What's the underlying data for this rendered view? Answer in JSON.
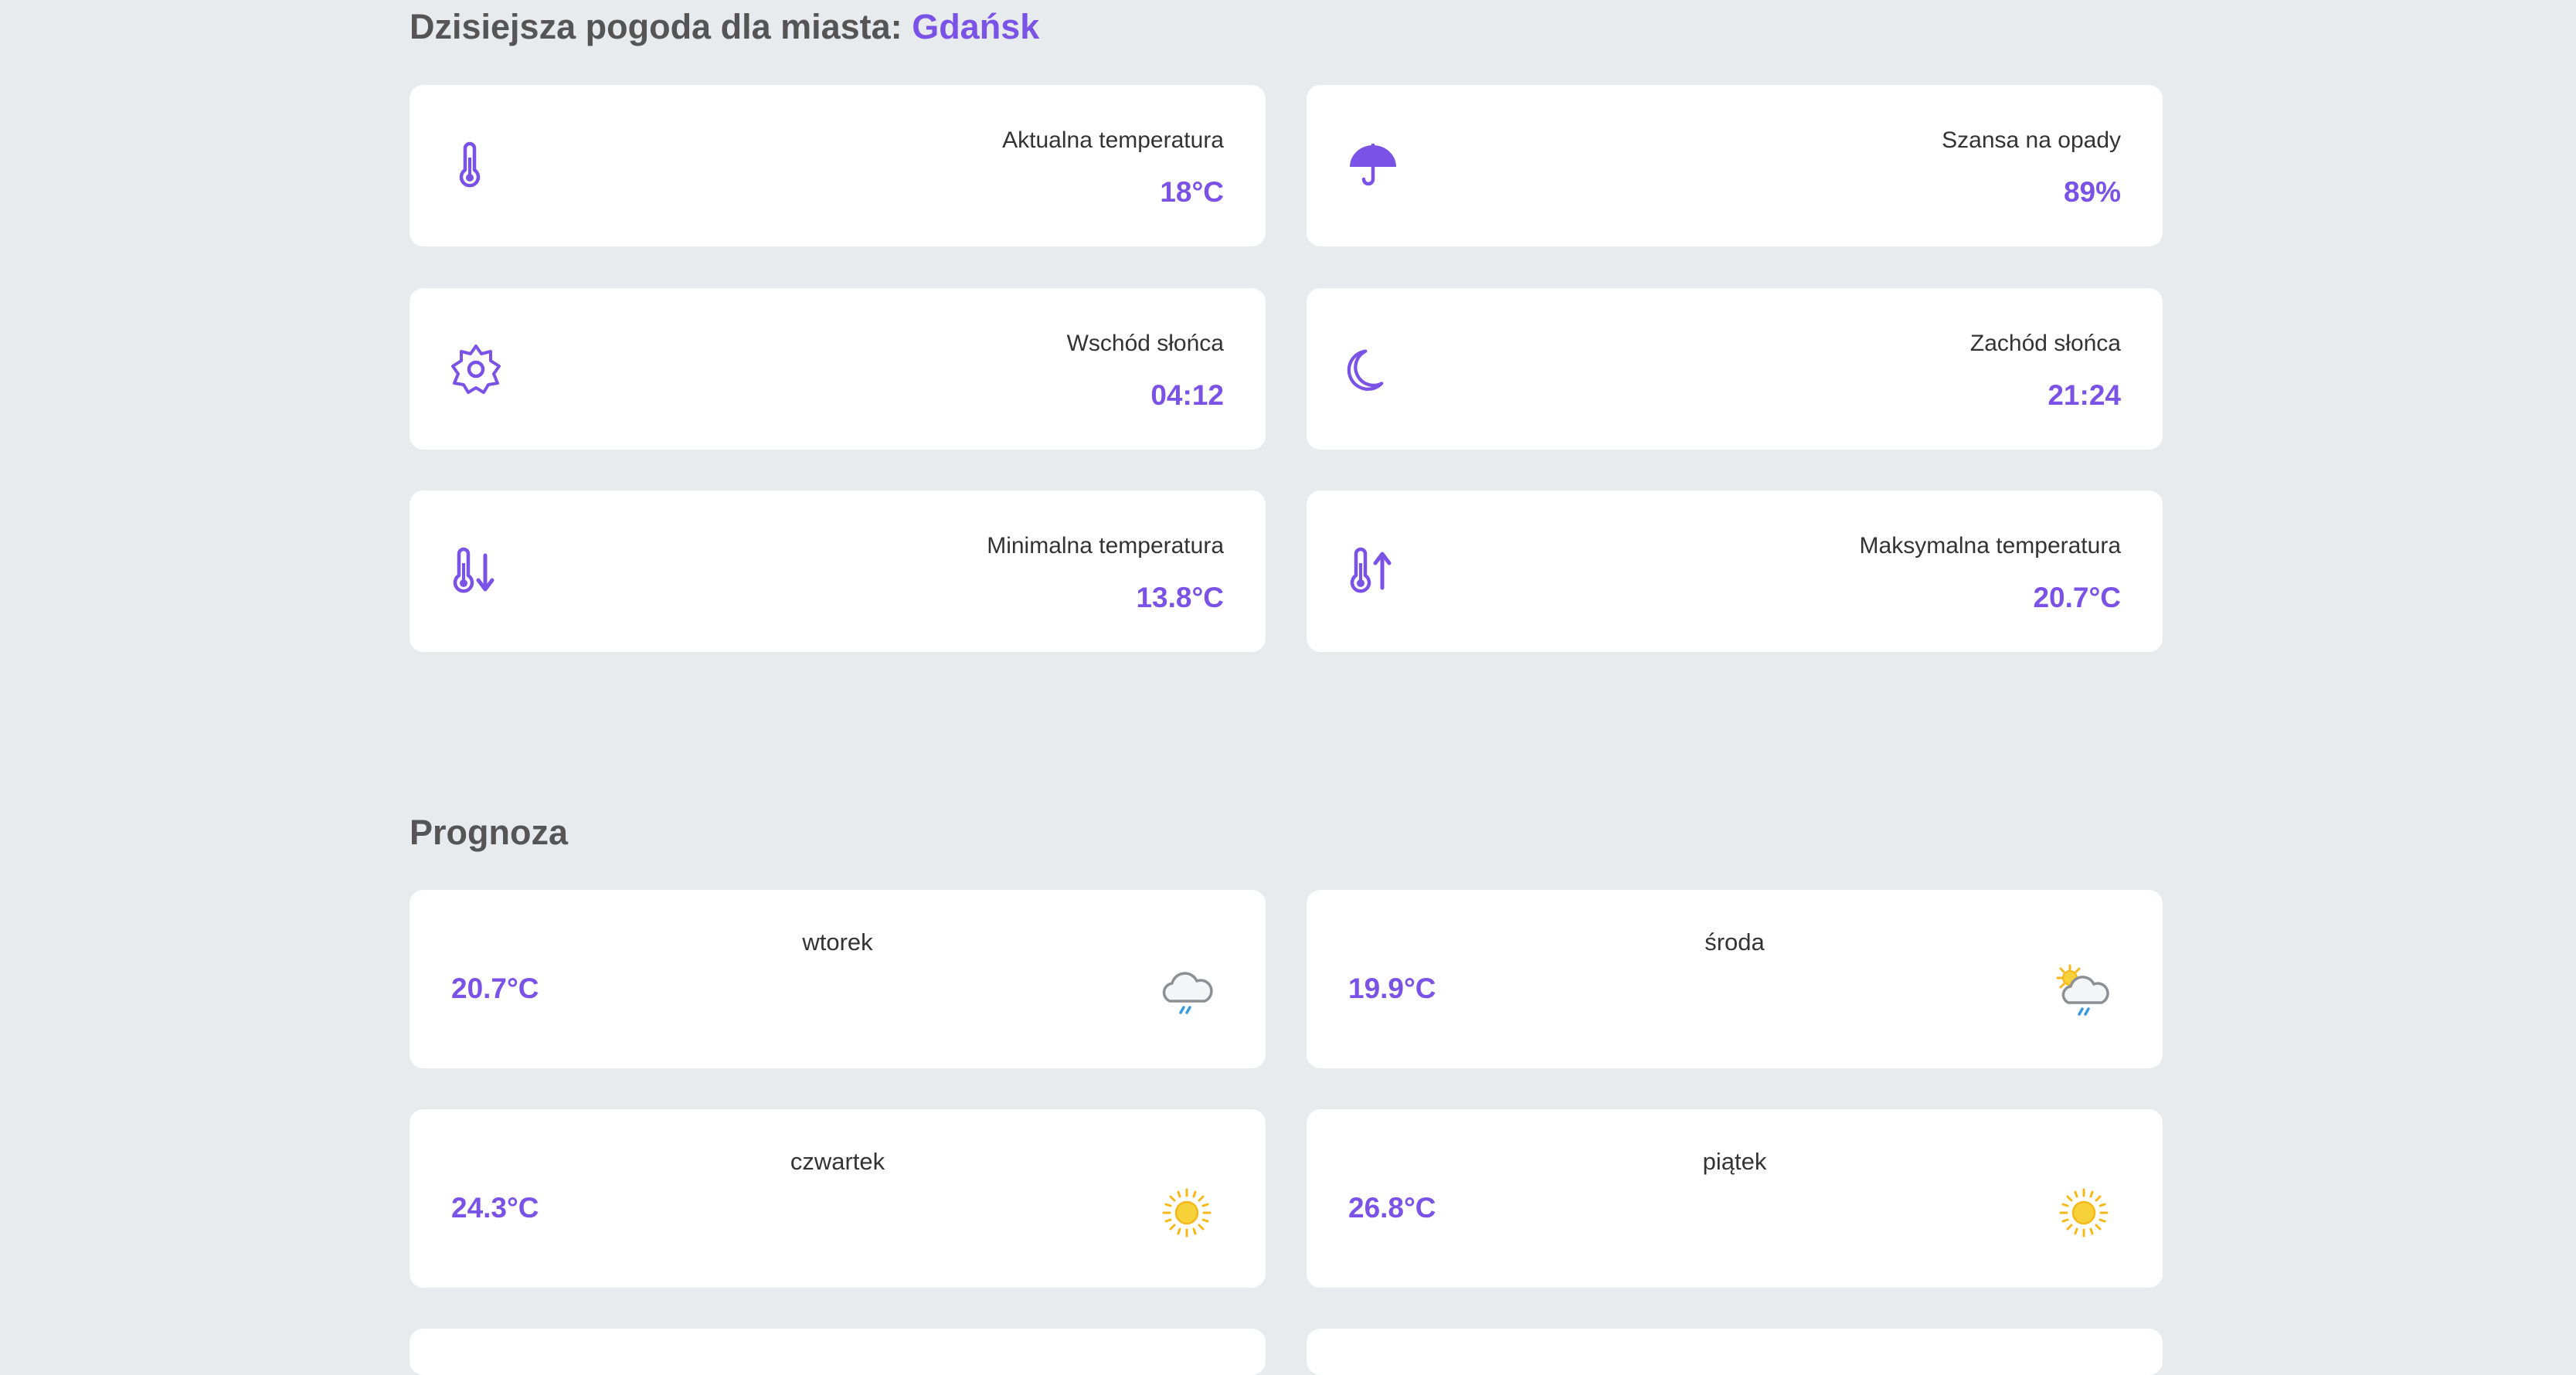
{
  "today": {
    "heading_prefix": "Dzisiejsza pogoda dla miasta:",
    "city": "Gdańsk",
    "cards": [
      {
        "label": "Aktualna temperatura",
        "value": "18°C",
        "icon": "thermometer-icon"
      },
      {
        "label": "Szansa na opady",
        "value": "89%",
        "icon": "umbrella-icon"
      },
      {
        "label": "Wschód słońca",
        "value": "04:12",
        "icon": "sun-icon"
      },
      {
        "label": "Zachód słońca",
        "value": "21:24",
        "icon": "moon-icon"
      },
      {
        "label": "Minimalna temperatura",
        "value": "13.8°C",
        "icon": "thermometer-down-icon"
      },
      {
        "label": "Maksymalna temperatura",
        "value": "20.7°C",
        "icon": "thermometer-up-icon"
      }
    ]
  },
  "forecast": {
    "heading": "Prognoza",
    "days": [
      {
        "day": "wtorek",
        "temp": "20.7°C",
        "icon": "rain-cloud-icon"
      },
      {
        "day": "środa",
        "temp": "19.9°C",
        "icon": "sun-cloud-rain-icon"
      },
      {
        "day": "czwartek",
        "temp": "24.3°C",
        "icon": "sunny-icon"
      },
      {
        "day": "piątek",
        "temp": "26.8°C",
        "icon": "sunny-icon"
      }
    ]
  },
  "colors": {
    "accent": "#7b52e6",
    "background": "#e8ebee",
    "card": "#ffffff",
    "heading": "#555555",
    "text": "#333333",
    "sun": "#f5c518"
  }
}
